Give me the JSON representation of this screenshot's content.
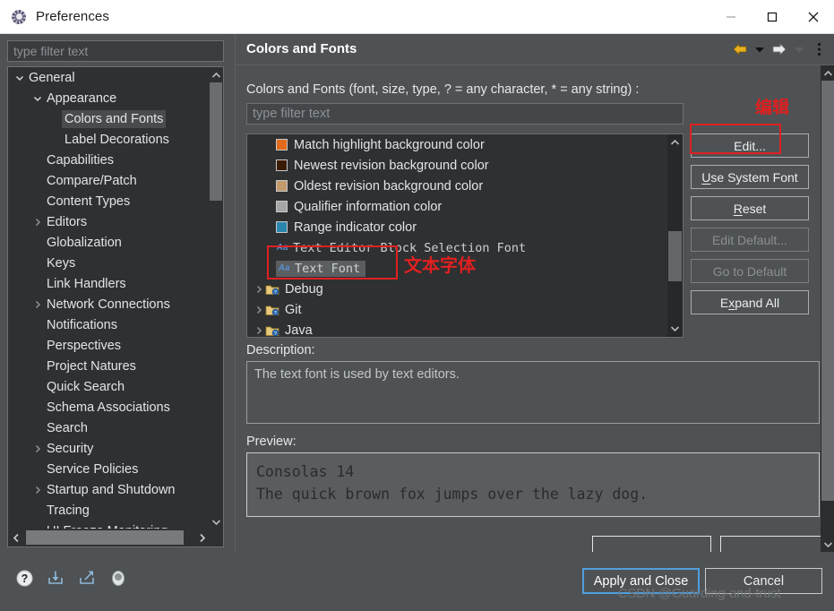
{
  "window": {
    "title": "Preferences",
    "icon": "preferences-gear-icon",
    "controls": {
      "minimize": "minimize-icon",
      "maximize": "maximize-icon",
      "close": "close-icon"
    }
  },
  "sidebar": {
    "filter_placeholder": "type filter text",
    "tree": [
      {
        "label": "General",
        "indent": 0,
        "arrow": "down",
        "selected": false
      },
      {
        "label": "Appearance",
        "indent": 1,
        "arrow": "down",
        "selected": false
      },
      {
        "label": "Colors and Fonts",
        "indent": 2,
        "arrow": "none",
        "selected": true
      },
      {
        "label": "Label Decorations",
        "indent": 2,
        "arrow": "none",
        "selected": false
      },
      {
        "label": "Capabilities",
        "indent": 1,
        "arrow": "none",
        "selected": false
      },
      {
        "label": "Compare/Patch",
        "indent": 1,
        "arrow": "none",
        "selected": false
      },
      {
        "label": "Content Types",
        "indent": 1,
        "arrow": "none",
        "selected": false
      },
      {
        "label": "Editors",
        "indent": 1,
        "arrow": "right",
        "selected": false
      },
      {
        "label": "Globalization",
        "indent": 1,
        "arrow": "none",
        "selected": false
      },
      {
        "label": "Keys",
        "indent": 1,
        "arrow": "none",
        "selected": false
      },
      {
        "label": "Link Handlers",
        "indent": 1,
        "arrow": "none",
        "selected": false
      },
      {
        "label": "Network Connections",
        "indent": 1,
        "arrow": "right",
        "selected": false
      },
      {
        "label": "Notifications",
        "indent": 1,
        "arrow": "none",
        "selected": false
      },
      {
        "label": "Perspectives",
        "indent": 1,
        "arrow": "none",
        "selected": false
      },
      {
        "label": "Project Natures",
        "indent": 1,
        "arrow": "none",
        "selected": false
      },
      {
        "label": "Quick Search",
        "indent": 1,
        "arrow": "none",
        "selected": false
      },
      {
        "label": "Schema Associations",
        "indent": 1,
        "arrow": "none",
        "selected": false
      },
      {
        "label": "Search",
        "indent": 1,
        "arrow": "none",
        "selected": false
      },
      {
        "label": "Security",
        "indent": 1,
        "arrow": "right",
        "selected": false
      },
      {
        "label": "Service Policies",
        "indent": 1,
        "arrow": "none",
        "selected": false
      },
      {
        "label": "Startup and Shutdown",
        "indent": 1,
        "arrow": "right",
        "selected": false
      },
      {
        "label": "Tracing",
        "indent": 1,
        "arrow": "none",
        "selected": false
      },
      {
        "label": "UI Freeze Monitoring",
        "indent": 1,
        "arrow": "none",
        "selected": false
      }
    ]
  },
  "content": {
    "title": "Colors and Fonts",
    "toolbar": [
      {
        "name": "back-arrow-icon",
        "enabled": true
      },
      {
        "name": "back-dropdown-icon",
        "enabled": true
      },
      {
        "name": "forward-arrow-icon",
        "enabled": true
      },
      {
        "name": "forward-dropdown-icon",
        "enabled": false
      },
      {
        "name": "view-menu-kebab-icon",
        "enabled": true
      }
    ],
    "filter_label": "Colors and Fonts (font, size, type, ? = any character, * = any string) :",
    "filter_placeholder": "type filter text",
    "list": [
      {
        "kind": "color",
        "label": "Match highlight background color",
        "swatch": "#e0691b"
      },
      {
        "kind": "color",
        "label": "Newest revision background color",
        "swatch": "#3a1c05"
      },
      {
        "kind": "color",
        "label": "Oldest revision background color",
        "swatch": "#c39a6b"
      },
      {
        "kind": "color",
        "label": "Qualifier information color",
        "swatch": "#a6a6a6"
      },
      {
        "kind": "color",
        "label": "Range indicator color",
        "swatch": "#2b86ae"
      },
      {
        "kind": "font",
        "label": "Text Editor Block Selection Font",
        "selected": false
      },
      {
        "kind": "font",
        "label": "Text Font",
        "selected": true
      },
      {
        "kind": "group",
        "label": "Debug"
      },
      {
        "kind": "group",
        "label": "Git"
      },
      {
        "kind": "group",
        "label": "Java"
      }
    ],
    "buttons": [
      {
        "label": "Edit...",
        "mnemonic": "E",
        "enabled": true,
        "name": "edit-button"
      },
      {
        "label": "Use System Font",
        "mnemonic": "U",
        "enabled": true,
        "name": "use-system-font-button"
      },
      {
        "label": "Reset",
        "mnemonic": "R",
        "enabled": true,
        "name": "reset-button"
      },
      {
        "label": "Edit Default...",
        "mnemonic": "",
        "enabled": false,
        "name": "edit-default-button"
      },
      {
        "label": "Go to Default",
        "mnemonic": "",
        "enabled": false,
        "name": "go-to-default-button"
      },
      {
        "label": "Expand All",
        "mnemonic": "x",
        "enabled": true,
        "name": "expand-all-button"
      }
    ],
    "description_label": "Description:",
    "description_text": "The text font is used by text editors.",
    "preview_label": "Preview:",
    "preview_line1": "Consolas 14",
    "preview_line2": "The quick brown fox jumps over the lazy dog."
  },
  "footer": {
    "icons": [
      {
        "name": "help-icon"
      },
      {
        "name": "import-preferences-icon"
      },
      {
        "name": "export-preferences-icon"
      },
      {
        "name": "restore-defaults-icon"
      }
    ],
    "apply_label": "Apply and Close",
    "cancel_label": "Cancel",
    "watermark": "CSDN @Guarding-and-trust"
  },
  "annotations": {
    "edit_cn": "编辑",
    "text_font_cn": "文本字体",
    "box_color": "#e02020"
  }
}
